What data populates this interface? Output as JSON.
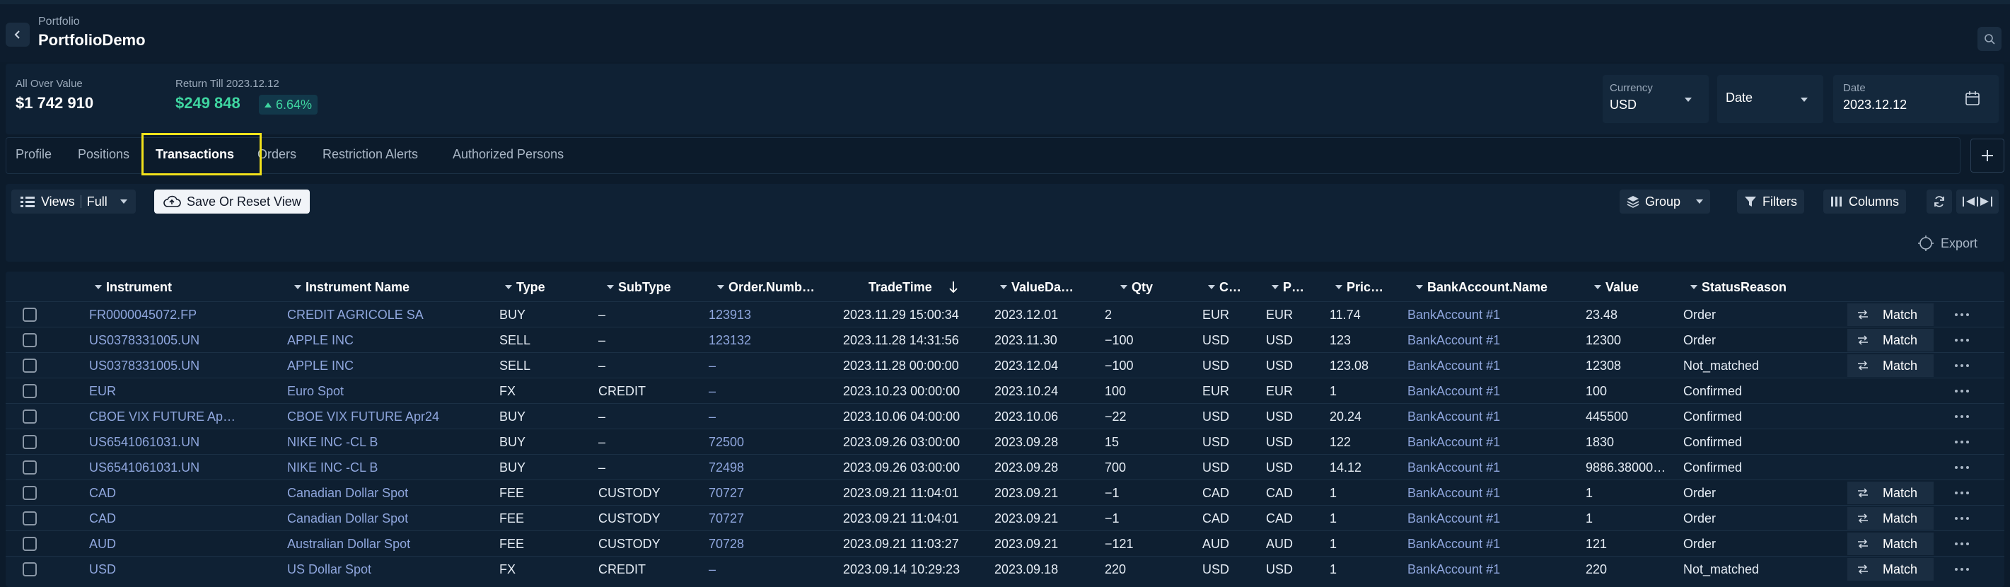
{
  "header": {
    "breadcrumb": "Portfolio",
    "title": "PortfolioDemo"
  },
  "summary": {
    "overall_label": "All Over Value",
    "overall_value": "$1 742 910",
    "return_label": "Return Till 2023.12.12",
    "return_value": "$249 848",
    "return_pct": "6.64%",
    "currency_label": "Currency",
    "currency_value": "USD",
    "date_select_label": "Date",
    "date_label": "Date",
    "date_value": "2023.12.12"
  },
  "tabs": [
    "Profile",
    "Positions",
    "Transactions",
    "Orders",
    "Restriction Alerts",
    "Authorized Persons"
  ],
  "active_tab": "Transactions",
  "toolbar": {
    "views_label": "Views",
    "views_value": "Full",
    "save_label": "Save Or Reset View",
    "group_label": "Group",
    "filters_label": "Filters",
    "columns_label": "Columns",
    "export_label": "Export"
  },
  "table": {
    "columns": [
      "Instrument",
      "Instrument Name",
      "Type",
      "SubType",
      "Order.Numb…",
      "TradeTime",
      "ValueDa…",
      "Qty",
      "C…",
      "P…",
      "Pric…",
      "BankAccount.Name",
      "Value",
      "StatusReason"
    ],
    "rows": [
      {
        "instrument": "FR0000045072.FP",
        "name": "CREDIT AGRICOLE SA",
        "type": "BUY",
        "subtype": "–",
        "order": "123913",
        "trade": "2023.11.29 15:00:34",
        "value_date": "2023.12.01",
        "qty": "2",
        "c": "EUR",
        "p": "EUR",
        "price": "11.74",
        "bank": "BankAccount #1",
        "value": "23.48",
        "status": "Order",
        "match": "Match"
      },
      {
        "instrument": "US0378331005.UN",
        "name": "APPLE INC",
        "type": "SELL",
        "subtype": "–",
        "order": "123132",
        "trade": "2023.11.28 14:31:56",
        "value_date": "2023.11.30",
        "qty": "−100",
        "c": "USD",
        "p": "USD",
        "price": "123",
        "bank": "BankAccount #1",
        "value": "12300",
        "status": "Order",
        "match": "Match"
      },
      {
        "instrument": "US0378331005.UN",
        "name": "APPLE INC",
        "type": "SELL",
        "subtype": "–",
        "order": "–",
        "trade": "2023.11.28 00:00:00",
        "value_date": "2023.12.04",
        "qty": "−100",
        "c": "USD",
        "p": "USD",
        "price": "123.08",
        "bank": "BankAccount #1",
        "value": "12308",
        "status": "Not_matched",
        "match": "Match"
      },
      {
        "instrument": "EUR",
        "name": "Euro Spot",
        "type": "FX",
        "subtype": "CREDIT",
        "order": "–",
        "trade": "2023.10.23 00:00:00",
        "value_date": "2023.10.24",
        "qty": "100",
        "c": "EUR",
        "p": "EUR",
        "price": "1",
        "bank": "BankAccount #1",
        "value": "100",
        "status": "Confirmed",
        "match": ""
      },
      {
        "instrument": "CBOE VIX FUTURE   Ap…",
        "name": "CBOE VIX FUTURE   Apr24",
        "type": "BUY",
        "subtype": "–",
        "order": "–",
        "trade": "2023.10.06 04:00:00",
        "value_date": "2023.10.06",
        "qty": "−22",
        "c": "USD",
        "p": "USD",
        "price": "20.24",
        "bank": "BankAccount #1",
        "value": "445500",
        "status": "Confirmed",
        "match": ""
      },
      {
        "instrument": "US6541061031.UN",
        "name": "NIKE INC -CL B",
        "type": "BUY",
        "subtype": "–",
        "order": "72500",
        "trade": "2023.09.26 03:00:00",
        "value_date": "2023.09.28",
        "qty": "15",
        "c": "USD",
        "p": "USD",
        "price": "122",
        "bank": "BankAccount #1",
        "value": "1830",
        "status": "Confirmed",
        "match": ""
      },
      {
        "instrument": "US6541061031.UN",
        "name": "NIKE INC -CL B",
        "type": "BUY",
        "subtype": "–",
        "order": "72498",
        "trade": "2023.09.26 03:00:00",
        "value_date": "2023.09.28",
        "qty": "700",
        "c": "USD",
        "p": "USD",
        "price": "14.12",
        "bank": "BankAccount #1",
        "value": "9886.38000…",
        "status": "Confirmed",
        "match": ""
      },
      {
        "instrument": "CAD",
        "name": "Canadian Dollar Spot",
        "type": "FEE",
        "subtype": "CUSTODY",
        "order": "70727",
        "trade": "2023.09.21 11:04:01",
        "value_date": "2023.09.21",
        "qty": "−1",
        "c": "CAD",
        "p": "CAD",
        "price": "1",
        "bank": "BankAccount #1",
        "value": "1",
        "status": "Order",
        "match": "Match"
      },
      {
        "instrument": "CAD",
        "name": "Canadian Dollar Spot",
        "type": "FEE",
        "subtype": "CUSTODY",
        "order": "70727",
        "trade": "2023.09.21 11:04:01",
        "value_date": "2023.09.21",
        "qty": "−1",
        "c": "CAD",
        "p": "CAD",
        "price": "1",
        "bank": "BankAccount #1",
        "value": "1",
        "status": "Order",
        "match": "Match"
      },
      {
        "instrument": "AUD",
        "name": "Australian Dollar Spot",
        "type": "FEE",
        "subtype": "CUSTODY",
        "order": "70728",
        "trade": "2023.09.21 11:03:27",
        "value_date": "2023.09.21",
        "qty": "−121",
        "c": "AUD",
        "p": "AUD",
        "price": "1",
        "bank": "BankAccount #1",
        "value": "121",
        "status": "Order",
        "match": "Match"
      },
      {
        "instrument": "USD",
        "name": "US Dollar Spot",
        "type": "FX",
        "subtype": "CREDIT",
        "order": "–",
        "trade": "2023.09.14 10:29:23",
        "value_date": "2023.09.18",
        "qty": "220",
        "c": "USD",
        "p": "USD",
        "price": "1",
        "bank": "BankAccount #1",
        "value": "220",
        "status": "Not_matched",
        "match": "Match"
      }
    ]
  },
  "colors": {
    "background": "#0c1b2b",
    "accent_green": "#3fd6a1",
    "link": "#8fa6dd",
    "highlight": "#f2e21b"
  },
  "icons": [
    "back-arrow-icon",
    "search-icon",
    "trend-up-icon",
    "chevron-down-icon",
    "calendar-icon",
    "plus-icon",
    "views-list-icon",
    "cloud-icon",
    "layers-icon",
    "filter-icon",
    "columns-icon",
    "refresh-icon",
    "split-icon",
    "export-icon",
    "sort-down-icon",
    "swap-icon",
    "more-icon"
  ]
}
